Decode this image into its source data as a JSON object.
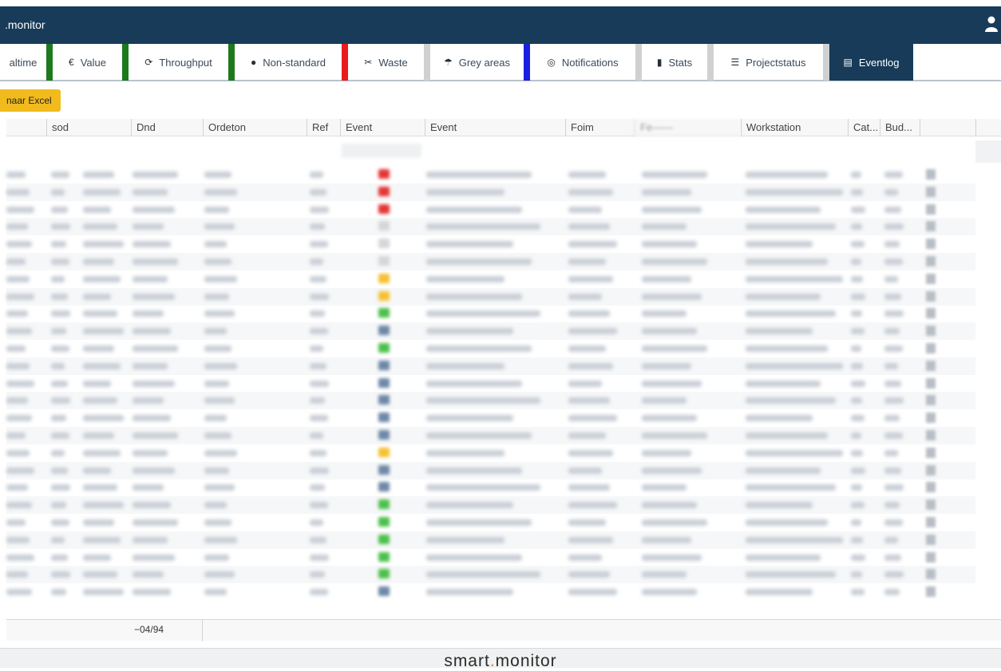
{
  "app": {
    "title": ".monitor",
    "brand_left": "smart",
    "brand_dot": ".",
    "brand_right": "monitor"
  },
  "tabs": [
    {
      "label": "altime",
      "icon": "",
      "sep_color": "#1c7a1c"
    },
    {
      "label": "Value",
      "icon": "€",
      "sep_color": "#1c7a1c"
    },
    {
      "label": "Throughput",
      "icon": "⟳",
      "sep_color": "#1c7a1c"
    },
    {
      "label": "Non-standard",
      "icon": "●",
      "sep_color": "#e81c1c"
    },
    {
      "label": "Waste",
      "icon": "✂",
      "sep_color": "#d0d0d0"
    },
    {
      "label": "Grey areas",
      "icon": "☂",
      "sep_color": "#1a20e0"
    },
    {
      "label": "Notifications",
      "icon": "◎",
      "sep_color": "#d0d0d0"
    },
    {
      "label": "Stats",
      "icon": "▮",
      "sep_color": "#d0d0d0"
    },
    {
      "label": "Projectstatus",
      "icon": "☰",
      "sep_color": "#d0d0d0"
    },
    {
      "label": "Eventlog",
      "icon": "▤",
      "active": true
    }
  ],
  "toolbar": {
    "excel_label": "naar Excel"
  },
  "table": {
    "columns": [
      "",
      "sod",
      "Dnd",
      "Ordeton",
      "Ref",
      "Event",
      "Event",
      "Foim",
      "Fe——",
      "Workstation",
      "Cat...",
      "Bud..."
    ]
  },
  "status_colors": {
    "red": "#e53535",
    "grey": "#d4d6d9",
    "yellow": "#f5c132",
    "green": "#4cc04c",
    "blue": "#6e88a8"
  },
  "row_events": [
    "red",
    "red",
    "red",
    "grey",
    "grey",
    "grey",
    "yellow",
    "yellow",
    "green",
    "blue",
    "green",
    "blue",
    "blue",
    "blue",
    "blue",
    "blue",
    "yellow",
    "blue",
    "blue",
    "green",
    "green",
    "green",
    "green",
    "green",
    "blue"
  ],
  "footer": {
    "pager": "−04/94"
  }
}
